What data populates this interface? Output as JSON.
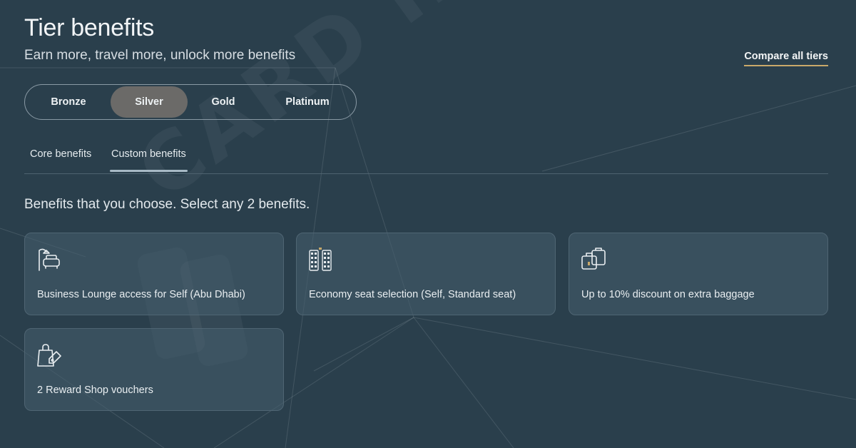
{
  "header": {
    "title": "Tier benefits",
    "subtitle": "Earn more, travel more, unlock more benefits",
    "compare_link": "Compare all tiers"
  },
  "tiers": {
    "selected": "Silver",
    "items": [
      {
        "label": "Bronze"
      },
      {
        "label": "Silver"
      },
      {
        "label": "Gold"
      },
      {
        "label": "Platinum"
      }
    ]
  },
  "subtabs": {
    "selected": "Custom benefits",
    "items": [
      {
        "label": "Core benefits"
      },
      {
        "label": "Custom benefits"
      }
    ]
  },
  "instructions": "Benefits that you choose. Select any 2 benefits.",
  "benefits": [
    {
      "icon": "lounge-chair-icon",
      "label": "Business Lounge access for Self (Abu Dhabi)"
    },
    {
      "icon": "seat-map-icon",
      "label": "Economy seat selection (Self, Standard seat)"
    },
    {
      "icon": "baggage-icon",
      "label": "Up to 10% discount on extra baggage"
    },
    {
      "icon": "shopping-bag-tag-icon",
      "label": "2 Reward Shop vouchers"
    }
  ],
  "watermark": {
    "text": "CARD INSIDER"
  },
  "colors": {
    "background": "#2a3f4c",
    "selected_tier": "#6b6a68",
    "link_underline": "#c9a96a",
    "icon_accent": "#c9a96a"
  }
}
